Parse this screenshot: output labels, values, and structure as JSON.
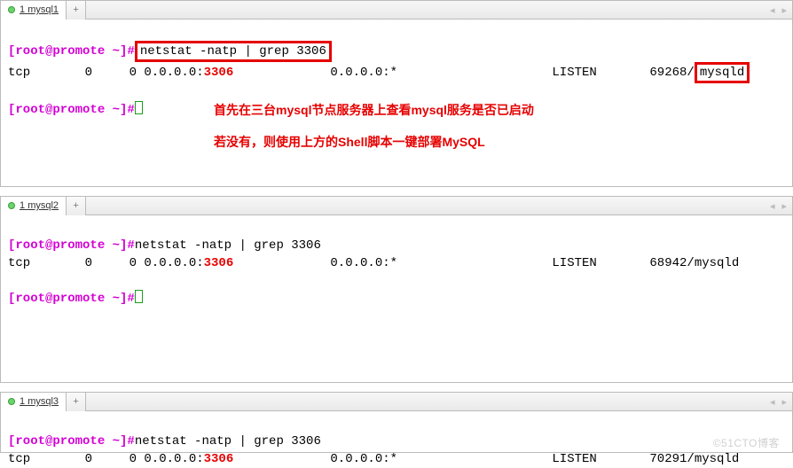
{
  "panes": [
    {
      "tab_num": "1",
      "tab_name": "mysql1",
      "add": "+",
      "nav_prev": "◂",
      "nav_next": "▸",
      "prompt": "[root@promote ~]#",
      "cmd": "netstat -natp | grep 3306",
      "row": {
        "proto": "tcp",
        "recv": "0",
        "send": "0",
        "local_pre": "0.0.0.0:",
        "local_port": "3306",
        "foreign": "0.0.0.0:*",
        "state": "LISTEN",
        "pid": "69268/",
        "proc": "mysqld"
      },
      "anno1": "首先在三台mysql节点服务器上查看mysql服务是否已启动",
      "anno2": "若没有，则使用上方的Shell脚本一键部署MySQL",
      "highlight": true
    },
    {
      "tab_num": "1",
      "tab_name": "mysql2",
      "add": "+",
      "nav_prev": "◂",
      "nav_next": "▸",
      "prompt": "[root@promote ~]#",
      "cmd": "netstat -natp | grep 3306",
      "row": {
        "proto": "tcp",
        "recv": "0",
        "send": "0",
        "local_pre": "0.0.0.0:",
        "local_port": "3306",
        "foreign": "0.0.0.0:*",
        "state": "LISTEN",
        "pid": "68942/",
        "proc": "mysqld"
      },
      "highlight": false
    },
    {
      "tab_num": "1",
      "tab_name": "mysql3",
      "add": "+",
      "nav_prev": "◂",
      "nav_next": "▸",
      "prompt": "[root@promote ~]#",
      "cmd": "netstat -natp | grep 3306",
      "row": {
        "proto": "tcp",
        "recv": "0",
        "send": "0",
        "local_pre": "0.0.0.0:",
        "local_port": "3306",
        "foreign": "0.0.0.0:*",
        "state": "LISTEN",
        "pid": "70291/",
        "proc": "mysqld"
      },
      "highlight": false
    }
  ],
  "watermark": "©51CTO博客"
}
